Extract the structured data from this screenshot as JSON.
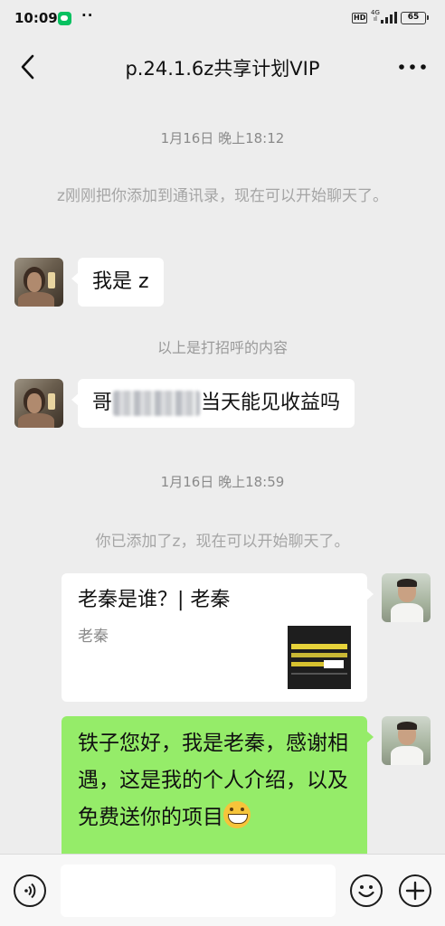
{
  "status_bar": {
    "time": "10:09",
    "app_icon": "wechat-icon",
    "more_dots": "··",
    "hd_badge": "HD",
    "network_top": "4G",
    "network_bottom": "ıl",
    "battery": "65"
  },
  "header": {
    "title": "p.24.1.6z共享计划VIP",
    "back_icon": "chevron-left-icon",
    "more_icon": "more-dots-icon"
  },
  "messages": {
    "time1": "1月16日 晚上18:12",
    "sys1": "z刚刚把你添加到通讯录，现在可以开始聊天了。",
    "msg1": "我是 z",
    "sys2": "以上是打招呼的内容",
    "msg2_prefix": "哥",
    "msg2_suffix": "当天能见收益吗",
    "time2": "1月16日 晚上18:59",
    "sys3": "你已添加了z，现在可以开始聊天了。",
    "card_title": "老秦是谁？| 老秦",
    "card_source": "老秦",
    "msg3_text": "铁子您好，我是老秦，感谢相遇，这是我的个人介绍，以及免费送你的项目"
  },
  "input_bar": {
    "voice_icon": "voice-icon",
    "emoji_icon": "emoji-icon",
    "plus_icon": "plus-icon"
  },
  "colors": {
    "background": "#ededed",
    "sent_bubble": "#95ec69",
    "received_bubble": "#ffffff",
    "system_text": "#a5a5a5"
  }
}
